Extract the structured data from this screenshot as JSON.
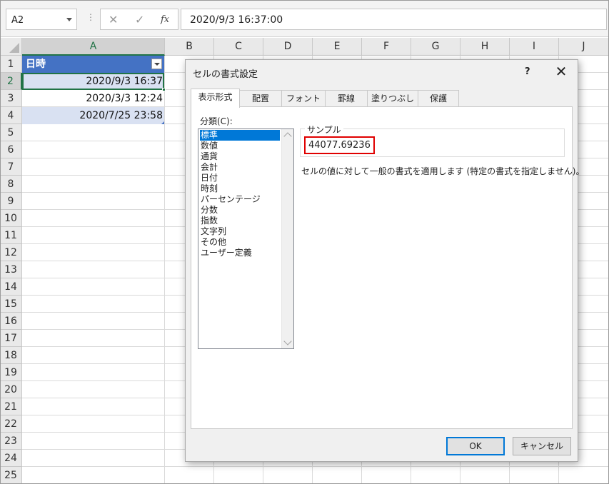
{
  "formula_bar": {
    "name_box": "A2",
    "dots": "⋮",
    "cancel_icon": "✕",
    "enter_icon": "✓",
    "fx_label": "fx",
    "formula": "2020/9/3  16:37:00"
  },
  "sheet": {
    "columns": [
      "A",
      "B",
      "C",
      "D",
      "E",
      "F",
      "G",
      "H",
      "I",
      "J"
    ],
    "rows": [
      "1",
      "2",
      "3",
      "4",
      "5",
      "6",
      "7",
      "8",
      "9",
      "10",
      "11",
      "12",
      "13",
      "14",
      "15",
      "16",
      "17",
      "18",
      "19",
      "20",
      "21",
      "22",
      "23",
      "24",
      "25"
    ],
    "header_cell": "日時",
    "cells": [
      "2020/9/3 16:37",
      "2020/3/3 12:24",
      "2020/7/25 23:58"
    ],
    "colors": {
      "table_header": "#4472c4",
      "band": "#d9e1f2",
      "select": "#217346"
    }
  },
  "dialog": {
    "title": "セルの書式設定",
    "help": "?",
    "close": "✕",
    "tabs": [
      "表示形式",
      "配置",
      "フォント",
      "罫線",
      "塗りつぶし",
      "保護"
    ],
    "category_label": "分類(C):",
    "categories": [
      "標準",
      "数値",
      "通貨",
      "会計",
      "日付",
      "時刻",
      "パーセンテージ",
      "分数",
      "指数",
      "文字列",
      "その他",
      "ユーザー定義"
    ],
    "sample_label": "サンプル",
    "sample_value": "44077.69236",
    "description": "セルの値に対して一般の書式を適用します (特定の書式を指定しません)。",
    "ok": "OK",
    "cancel": "キャンセル"
  }
}
